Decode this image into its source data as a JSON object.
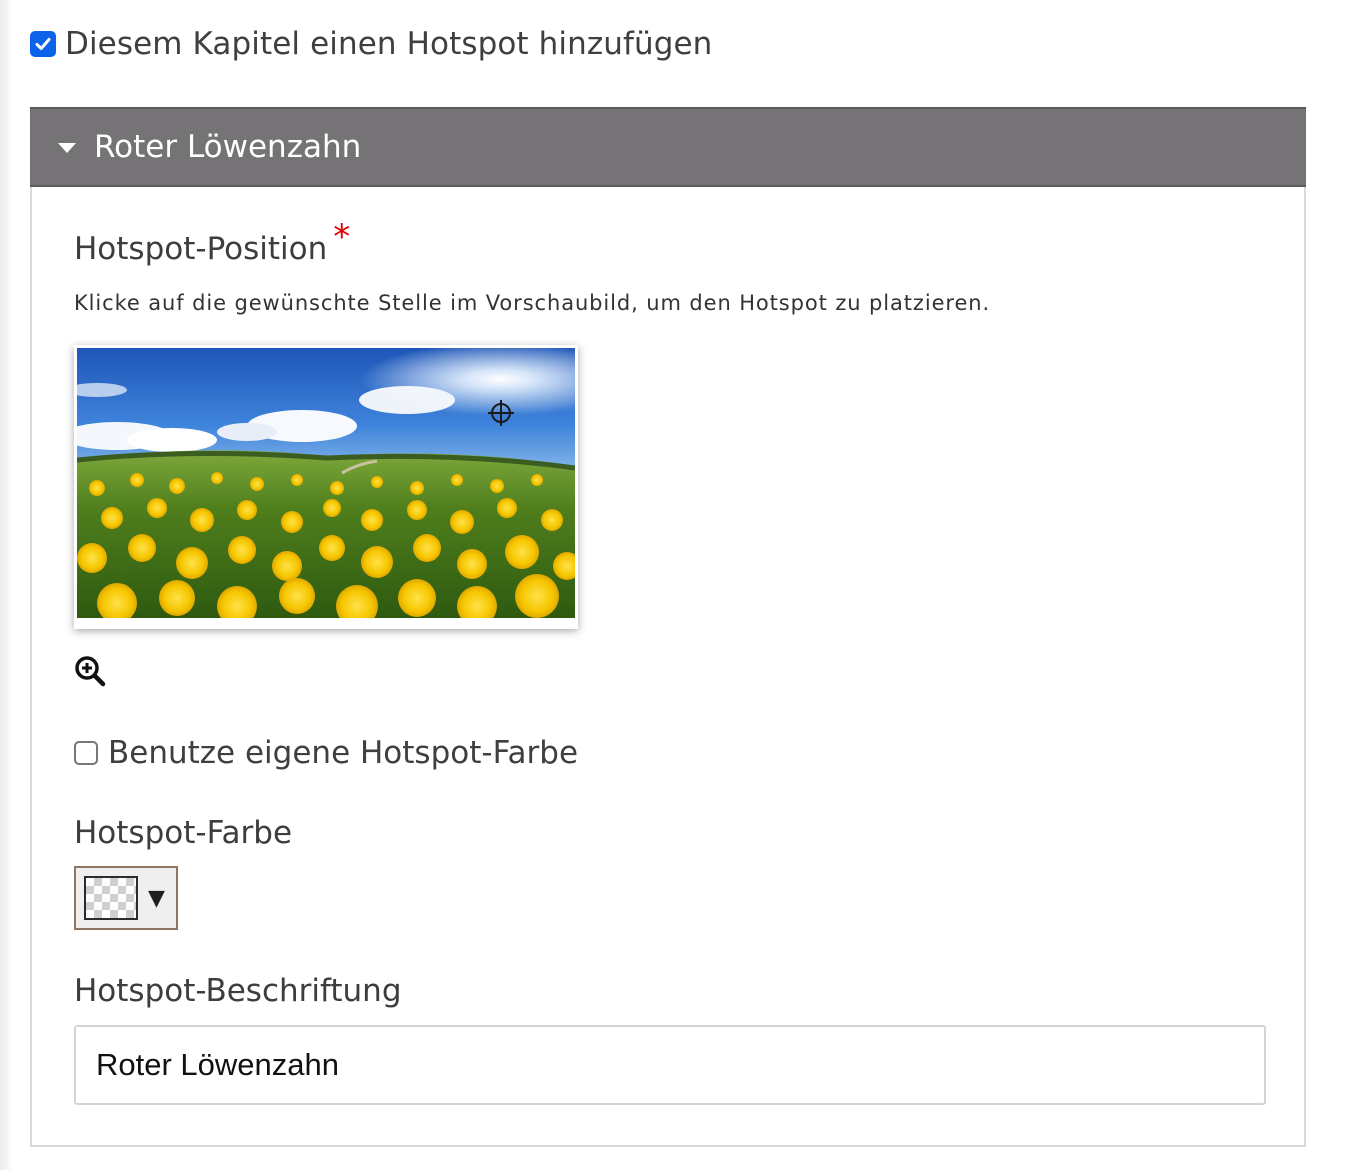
{
  "add_hotspot": {
    "checked": true,
    "label": "Diesem Kapitel einen Hotspot hinzufügen"
  },
  "panel": {
    "title": "Roter Löwenzahn",
    "expanded": true
  },
  "hotspot_position": {
    "label": "Hotspot-Position",
    "required_marker": "*",
    "help": "Klicke auf die gewünschte Stelle im Vorschaubild, um den Hotspot zu platzieren."
  },
  "custom_color": {
    "checked": false,
    "label": "Benutze eigene Hotspot-Farbe"
  },
  "hotspot_color": {
    "label": "Hotspot-Farbe",
    "arrow": "▼"
  },
  "hotspot_caption": {
    "label": "Hotspot-Beschriftung",
    "value": "Roter Löwenzahn"
  },
  "colors": {
    "header_bg": "#757375",
    "checkbox_accent": "#0a63e8",
    "required": "#e00000"
  },
  "icons": {
    "checkbox": "checkmark-icon",
    "caret": "caret-down-icon",
    "crosshair": "crosshair-icon",
    "zoom": "zoom-in-icon"
  }
}
